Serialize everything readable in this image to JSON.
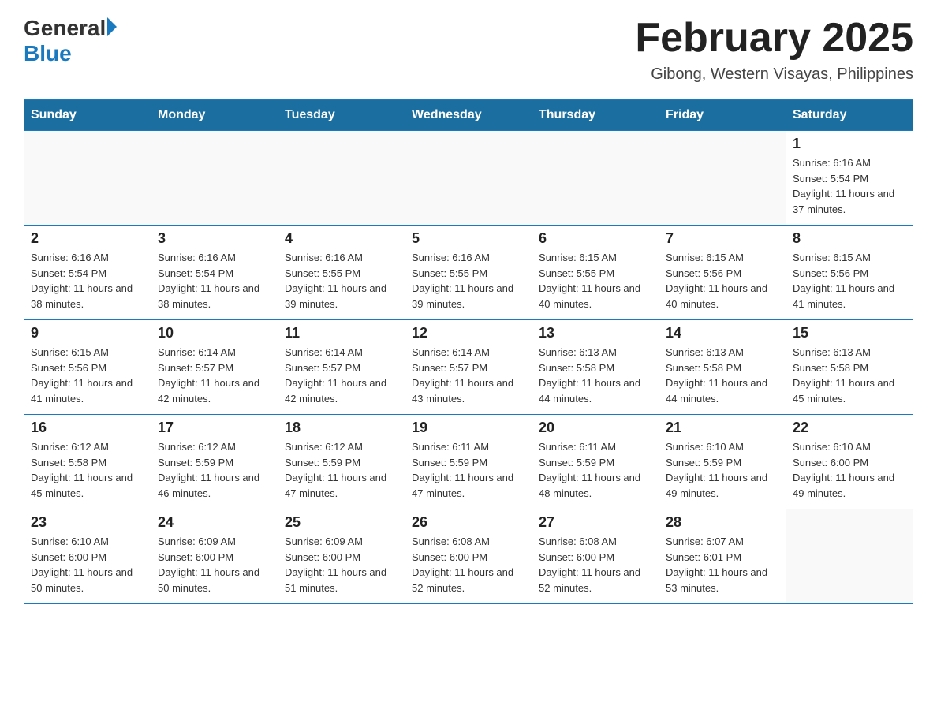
{
  "header": {
    "logo_general": "General",
    "logo_blue": "Blue",
    "title": "February 2025",
    "subtitle": "Gibong, Western Visayas, Philippines"
  },
  "days_of_week": [
    "Sunday",
    "Monday",
    "Tuesday",
    "Wednesday",
    "Thursday",
    "Friday",
    "Saturday"
  ],
  "weeks": [
    {
      "days": [
        {
          "number": "",
          "info": ""
        },
        {
          "number": "",
          "info": ""
        },
        {
          "number": "",
          "info": ""
        },
        {
          "number": "",
          "info": ""
        },
        {
          "number": "",
          "info": ""
        },
        {
          "number": "",
          "info": ""
        },
        {
          "number": "1",
          "info": "Sunrise: 6:16 AM\nSunset: 5:54 PM\nDaylight: 11 hours and 37 minutes."
        }
      ]
    },
    {
      "days": [
        {
          "number": "2",
          "info": "Sunrise: 6:16 AM\nSunset: 5:54 PM\nDaylight: 11 hours and 38 minutes."
        },
        {
          "number": "3",
          "info": "Sunrise: 6:16 AM\nSunset: 5:54 PM\nDaylight: 11 hours and 38 minutes."
        },
        {
          "number": "4",
          "info": "Sunrise: 6:16 AM\nSunset: 5:55 PM\nDaylight: 11 hours and 39 minutes."
        },
        {
          "number": "5",
          "info": "Sunrise: 6:16 AM\nSunset: 5:55 PM\nDaylight: 11 hours and 39 minutes."
        },
        {
          "number": "6",
          "info": "Sunrise: 6:15 AM\nSunset: 5:55 PM\nDaylight: 11 hours and 40 minutes."
        },
        {
          "number": "7",
          "info": "Sunrise: 6:15 AM\nSunset: 5:56 PM\nDaylight: 11 hours and 40 minutes."
        },
        {
          "number": "8",
          "info": "Sunrise: 6:15 AM\nSunset: 5:56 PM\nDaylight: 11 hours and 41 minutes."
        }
      ]
    },
    {
      "days": [
        {
          "number": "9",
          "info": "Sunrise: 6:15 AM\nSunset: 5:56 PM\nDaylight: 11 hours and 41 minutes."
        },
        {
          "number": "10",
          "info": "Sunrise: 6:14 AM\nSunset: 5:57 PM\nDaylight: 11 hours and 42 minutes."
        },
        {
          "number": "11",
          "info": "Sunrise: 6:14 AM\nSunset: 5:57 PM\nDaylight: 11 hours and 42 minutes."
        },
        {
          "number": "12",
          "info": "Sunrise: 6:14 AM\nSunset: 5:57 PM\nDaylight: 11 hours and 43 minutes."
        },
        {
          "number": "13",
          "info": "Sunrise: 6:13 AM\nSunset: 5:58 PM\nDaylight: 11 hours and 44 minutes."
        },
        {
          "number": "14",
          "info": "Sunrise: 6:13 AM\nSunset: 5:58 PM\nDaylight: 11 hours and 44 minutes."
        },
        {
          "number": "15",
          "info": "Sunrise: 6:13 AM\nSunset: 5:58 PM\nDaylight: 11 hours and 45 minutes."
        }
      ]
    },
    {
      "days": [
        {
          "number": "16",
          "info": "Sunrise: 6:12 AM\nSunset: 5:58 PM\nDaylight: 11 hours and 45 minutes."
        },
        {
          "number": "17",
          "info": "Sunrise: 6:12 AM\nSunset: 5:59 PM\nDaylight: 11 hours and 46 minutes."
        },
        {
          "number": "18",
          "info": "Sunrise: 6:12 AM\nSunset: 5:59 PM\nDaylight: 11 hours and 47 minutes."
        },
        {
          "number": "19",
          "info": "Sunrise: 6:11 AM\nSunset: 5:59 PM\nDaylight: 11 hours and 47 minutes."
        },
        {
          "number": "20",
          "info": "Sunrise: 6:11 AM\nSunset: 5:59 PM\nDaylight: 11 hours and 48 minutes."
        },
        {
          "number": "21",
          "info": "Sunrise: 6:10 AM\nSunset: 5:59 PM\nDaylight: 11 hours and 49 minutes."
        },
        {
          "number": "22",
          "info": "Sunrise: 6:10 AM\nSunset: 6:00 PM\nDaylight: 11 hours and 49 minutes."
        }
      ]
    },
    {
      "days": [
        {
          "number": "23",
          "info": "Sunrise: 6:10 AM\nSunset: 6:00 PM\nDaylight: 11 hours and 50 minutes."
        },
        {
          "number": "24",
          "info": "Sunrise: 6:09 AM\nSunset: 6:00 PM\nDaylight: 11 hours and 50 minutes."
        },
        {
          "number": "25",
          "info": "Sunrise: 6:09 AM\nSunset: 6:00 PM\nDaylight: 11 hours and 51 minutes."
        },
        {
          "number": "26",
          "info": "Sunrise: 6:08 AM\nSunset: 6:00 PM\nDaylight: 11 hours and 52 minutes."
        },
        {
          "number": "27",
          "info": "Sunrise: 6:08 AM\nSunset: 6:00 PM\nDaylight: 11 hours and 52 minutes."
        },
        {
          "number": "28",
          "info": "Sunrise: 6:07 AM\nSunset: 6:01 PM\nDaylight: 11 hours and 53 minutes."
        },
        {
          "number": "",
          "info": ""
        }
      ]
    }
  ]
}
